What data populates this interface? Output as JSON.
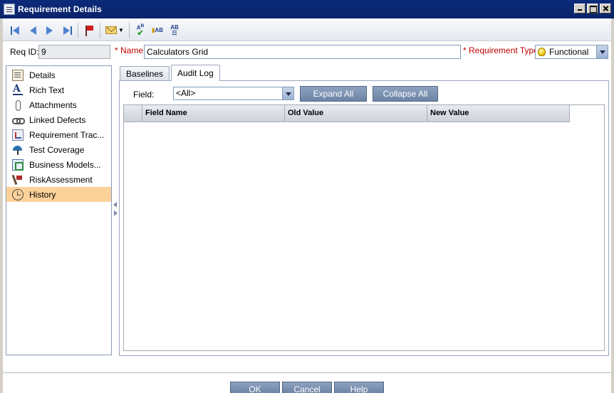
{
  "window": {
    "title": "Requirement Details"
  },
  "toolbar": {
    "buttons": [
      {
        "name": "first-record-icon"
      },
      {
        "name": "previous-record-icon"
      },
      {
        "name": "next-record-icon"
      },
      {
        "name": "last-record-icon"
      },
      {
        "name": "flag-icon"
      },
      {
        "name": "send-mail-icon"
      },
      {
        "name": "spell-check-icon"
      },
      {
        "name": "thesaurus-icon"
      },
      {
        "name": "spelling-options-icon"
      }
    ]
  },
  "header": {
    "req_id_label": "Req ID:",
    "req_id_value": "9",
    "required_mark": "*",
    "name_label": "Name:",
    "name_value": "Calculators Grid",
    "type_label": "Requirement Type:",
    "type_value": "Functional"
  },
  "sidebar": {
    "items": [
      {
        "label": "Details",
        "icon": "details-icon",
        "active": false
      },
      {
        "label": "Rich Text",
        "icon": "rich-text-icon",
        "active": false
      },
      {
        "label": "Attachments",
        "icon": "attachment-icon",
        "active": false
      },
      {
        "label": "Linked Defects",
        "icon": "link-icon",
        "active": false
      },
      {
        "label": "Requirement Trac...",
        "icon": "traceability-icon",
        "active": false
      },
      {
        "label": "Test Coverage",
        "icon": "umbrella-icon",
        "active": false
      },
      {
        "label": "Business Models...",
        "icon": "business-model-icon",
        "active": false
      },
      {
        "label": "RiskAssessment",
        "icon": "risk-flag-icon",
        "active": false
      },
      {
        "label": "History",
        "icon": "history-icon",
        "active": true
      }
    ]
  },
  "tabs": [
    {
      "label": "Baselines",
      "active": false
    },
    {
      "label": "Audit Log",
      "active": true
    }
  ],
  "audit": {
    "field_label": "Field:",
    "field_value": "<All>",
    "expand_all": "Expand All",
    "collapse_all": "Collapse All",
    "columns": [
      "",
      "Field Name",
      "Old Value",
      "New Value"
    ]
  },
  "footer": {
    "ok": "OK",
    "cancel": "Cancel",
    "help": "Help"
  },
  "colors": {
    "titlebar": "#0a246a",
    "active_item": "#fcd29a",
    "required": "#c00000"
  }
}
